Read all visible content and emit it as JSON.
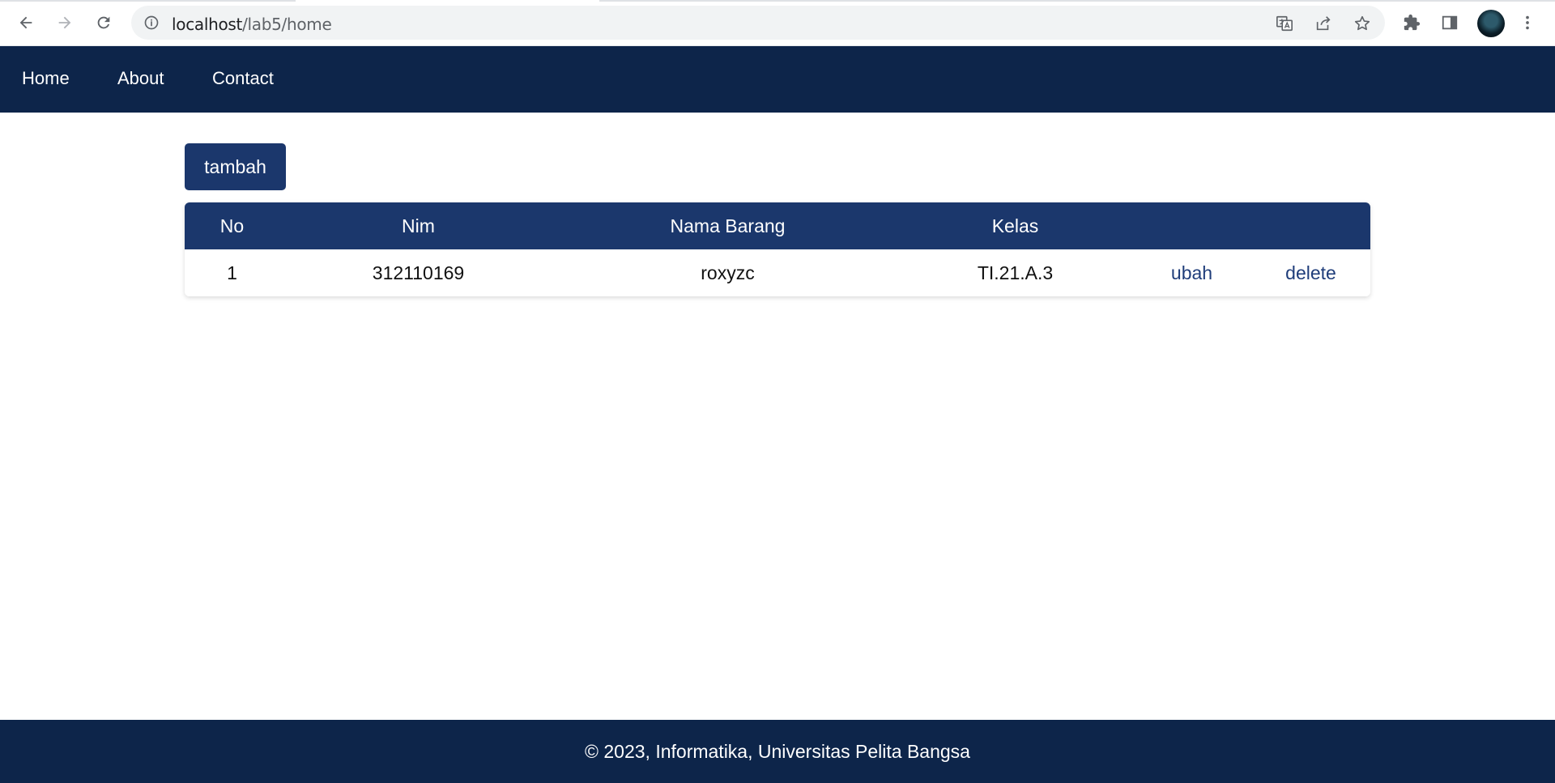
{
  "browser": {
    "url_host": "localhost",
    "url_path": "/lab5/home"
  },
  "nav": {
    "items": [
      {
        "label": "Home"
      },
      {
        "label": "About"
      },
      {
        "label": "Contact"
      }
    ]
  },
  "main": {
    "add_button_label": "tambah",
    "table": {
      "headers": [
        "No",
        "Nim",
        "Nama Barang",
        "Kelas",
        "",
        ""
      ],
      "rows": [
        {
          "no": "1",
          "nim": "312110169",
          "nama_barang": "roxyzc",
          "kelas": "TI.21.A.3",
          "edit_label": "ubah",
          "delete_label": "delete"
        }
      ]
    }
  },
  "footer": {
    "text": "© 2023, Informatika, Universitas Pelita Bangsa"
  },
  "colors": {
    "navbar": "#0d254a",
    "primary": "#1b376c",
    "link": "#1f3d7a"
  },
  "icons": [
    "back-arrow-icon",
    "forward-arrow-icon",
    "reload-icon",
    "info-icon",
    "translate-icon",
    "share-icon",
    "star-icon",
    "extensions-icon",
    "side-panel-icon",
    "profile-avatar",
    "more-menu-icon"
  ]
}
